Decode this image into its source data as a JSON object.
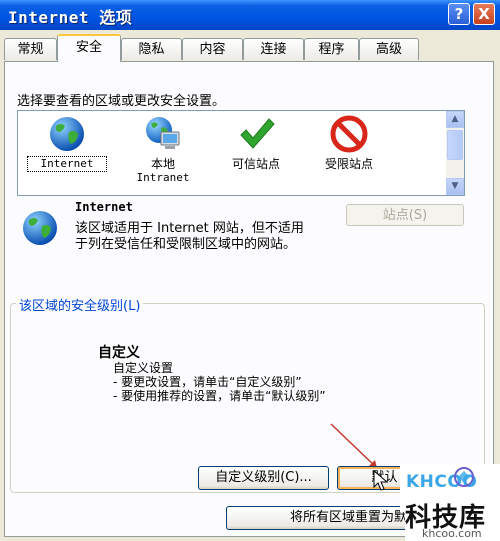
{
  "window": {
    "title": "Internet 选项",
    "help_label": "?",
    "close_label": "X"
  },
  "tabs": [
    {
      "label": "常规"
    },
    {
      "label": "安全",
      "active": true
    },
    {
      "label": "隐私"
    },
    {
      "label": "内容"
    },
    {
      "label": "连接"
    },
    {
      "label": "程序"
    },
    {
      "label": "高级"
    }
  ],
  "security": {
    "prompt": "选择要查看的区域或更改安全设置。",
    "zones": [
      {
        "line1": "Internet",
        "line2": "",
        "icon": "globe-icon",
        "selected": true
      },
      {
        "line1": "本地",
        "line2": "Intranet",
        "icon": "computer-globe-icon"
      },
      {
        "line1": "可信站点",
        "line2": "",
        "icon": "checkmark-icon"
      },
      {
        "line1": "受限站点",
        "line2": "",
        "icon": "no-entry-icon"
      }
    ],
    "zone_name": "Internet",
    "zone_description": "该区域适用于 Internet 网站，但不适用于列在受信任和受限制区域中的网站。",
    "sites_button": "站点(S)",
    "level_group_title": "该区域的安全级别(L)",
    "level_name": "自定义",
    "level_lines": [
      "自定义设置",
      "- 要更改设置，请单击“自定义级别”",
      "- 要使用推荐的设置，请单击“默认级别”"
    ],
    "custom_level_button": "自定义级别(C)...",
    "default_level_button": "默认",
    "reset_all_button": "将所有区域重置为默认"
  },
  "watermark": {
    "logo": "KHCOO",
    "name": "科技库",
    "url": "khcoo.com"
  },
  "colors": {
    "titlebar": "#0054e3",
    "tab_highlight": "#ffc83c",
    "group_title": "#0046d5",
    "annotation_arrow": "#c0392b"
  }
}
